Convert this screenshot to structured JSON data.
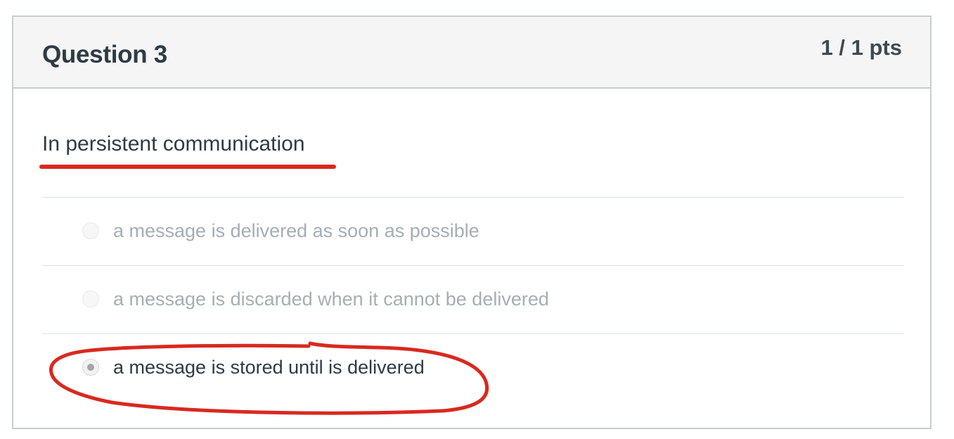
{
  "question": {
    "title": "Question 3",
    "points": "1 / 1 pts",
    "text": "In persistent communication"
  },
  "answers": [
    {
      "label": "a message is delivered as soon as possible",
      "selected": false
    },
    {
      "label": "a message is discarded when it cannot be delivered",
      "selected": false
    },
    {
      "label": "a message is stored until is delivered",
      "selected": true
    }
  ],
  "annotation_color": "#d9291f"
}
